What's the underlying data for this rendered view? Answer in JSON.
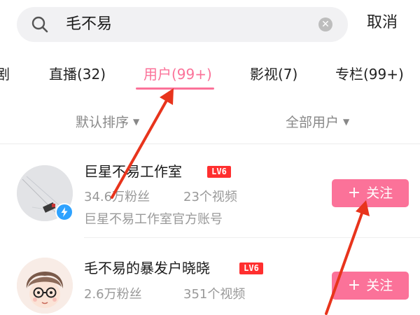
{
  "search": {
    "query": "毛不易",
    "cancel_label": "取消"
  },
  "tabs": [
    {
      "label": "剧",
      "active": false
    },
    {
      "label": "直播(32)",
      "active": false
    },
    {
      "label": "用户(99+)",
      "active": true
    },
    {
      "label": "影视(7)",
      "active": false
    },
    {
      "label": "专栏(99+)",
      "active": false
    }
  ],
  "filters": {
    "sort": "默认排序",
    "scope": "全部用户"
  },
  "results": [
    {
      "name": "巨星不易工作室",
      "level": "LV6",
      "followers": "34.6万粉丝",
      "videos": "23个视频",
      "description": "巨星不易工作室官方账号",
      "follow_label": "关注",
      "verified": true
    },
    {
      "name": "毛不易的暴发户晓晓",
      "level": "LV6",
      "followers": "2.6万粉丝",
      "videos": "351个视频",
      "follow_label": "关注",
      "verified": false
    }
  ],
  "colors": {
    "accent": "#fb7299",
    "level_badge": "#ff2f2f",
    "verified_badge": "#2ea2ff",
    "annotation_arrow": "#e8341c"
  },
  "icons": {
    "search": "search-icon",
    "clear": "clear-icon",
    "caret": "chevron-down-icon",
    "verified": "lightning-icon",
    "plus": "plus-icon",
    "annotation": "arrow-annotation"
  }
}
